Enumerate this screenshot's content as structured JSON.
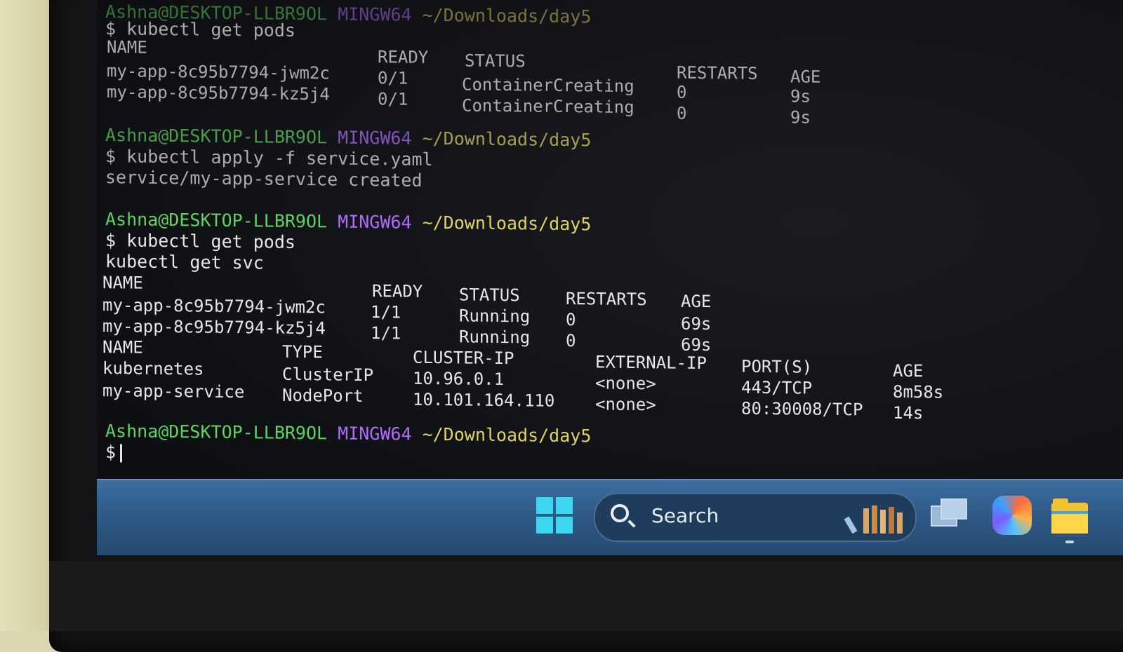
{
  "terminal": {
    "prev": {
      "prompt_user": "Ashna@DESKTOP-LLBR9OL",
      "prompt_env": "MINGW64",
      "prompt_path": "~/Downloads/day5",
      "command": "$ kubectl get pods",
      "header": [
        "NAME",
        "READY",
        "STATUS",
        "RESTARTS",
        "AGE"
      ],
      "rows": [
        [
          "my-app-8c95b7794-jwm2c",
          "0/1",
          "ContainerCreating",
          "0",
          "9s"
        ],
        [
          "my-app-8c95b7794-kz5j4",
          "0/1",
          "ContainerCreating",
          "0",
          "9s"
        ]
      ]
    },
    "apply": {
      "prompt_user": "Ashna@DESKTOP-LLBR9OL",
      "prompt_env": "MINGW64",
      "prompt_path": "~/Downloads/day5",
      "command": "$ kubectl apply -f service.yaml",
      "output": "service/my-app-service created"
    },
    "get": {
      "prompt_user": "Ashna@DESKTOP-LLBR9OL",
      "prompt_env": "MINGW64",
      "prompt_path": "~/Downloads/day5",
      "command1": "$ kubectl get pods",
      "command2": "kubectl get svc",
      "pods_header": [
        "NAME",
        "READY",
        "STATUS",
        "RESTARTS",
        "AGE"
      ],
      "pods": [
        [
          "my-app-8c95b7794-jwm2c",
          "1/1",
          "Running",
          "0",
          "69s"
        ],
        [
          "my-app-8c95b7794-kz5j4",
          "1/1",
          "Running",
          "0",
          "69s"
        ]
      ],
      "svc_header": [
        "NAME",
        "TYPE",
        "CLUSTER-IP",
        "EXTERNAL-IP",
        "PORT(S)",
        "AGE"
      ],
      "svc": [
        [
          "kubernetes",
          "ClusterIP",
          "10.96.0.1",
          "<none>",
          "443/TCP",
          "8m58s"
        ],
        [
          "my-app-service",
          "NodePort",
          "10.101.164.110",
          "<none>",
          "80:30008/TCP",
          "14s"
        ]
      ]
    },
    "current": {
      "prompt_user": "Ashna@DESKTOP-LLBR9OL",
      "prompt_env": "MINGW64",
      "prompt_path": "~/Downloads/day5",
      "input": "$"
    }
  },
  "taskbar": {
    "search_label": "Search",
    "icons": [
      "windows-start-icon",
      "search-icon",
      "books-icon",
      "task-view-icon",
      "copilot-icon",
      "file-explorer-icon"
    ]
  }
}
